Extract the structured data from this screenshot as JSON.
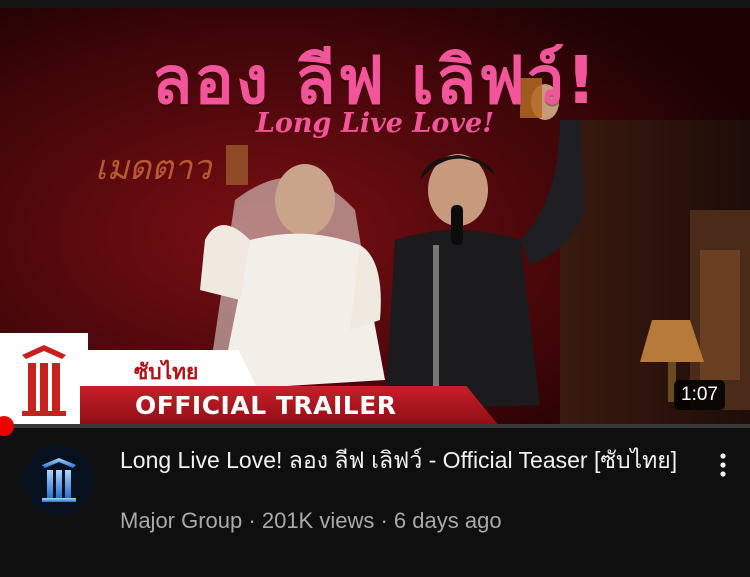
{
  "thumbnail": {
    "title_thai": "ลอง ลีฟ เลิฟว์!",
    "title_english": "Long Live Love!",
    "neon_sign": "เมดตาว",
    "subtitle_badge": "ซับไทย",
    "trailer_badge": "OFFICIAL TRAILER",
    "duration": "1:07",
    "progress_fraction": 0.005
  },
  "video": {
    "title": "Long Live Love! ลอง ลีฟ เลิฟว์ - Official Teaser [ซับไทย]",
    "channel": "Major Group",
    "views": "201K views",
    "age": "6 days ago",
    "separator": " · "
  },
  "icons": {
    "channel_avatar": "major-group-logo-icon",
    "more": "more-vertical-icon"
  },
  "colors": {
    "accent_pink": "#f2559a",
    "trailer_red": "#b01218",
    "progress_red": "#ff0000"
  }
}
